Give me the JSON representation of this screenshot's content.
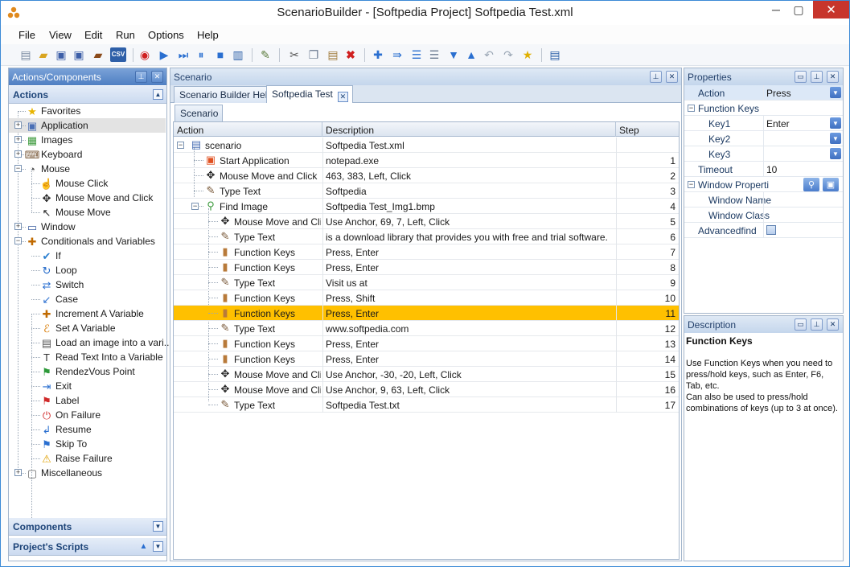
{
  "window": {
    "title": "ScenarioBuilder - [Softpedia Project] Softpedia Test.xml",
    "min": "─",
    "max": "▢",
    "close": "✕"
  },
  "menu": [
    "File",
    "View",
    "Edit",
    "Run",
    "Options",
    "Help"
  ],
  "toolbar": {
    "csv_label": "CSV"
  },
  "left": {
    "title": "Actions/Components",
    "pin": "⊥",
    "close": "✕",
    "actions_header": "Actions",
    "components_header": "Components",
    "scripts_header": "Project's Scripts",
    "tree": [
      {
        "label": "Favorites",
        "icon": "star-icon",
        "glyph": "★",
        "color": "#e8b400"
      },
      {
        "label": "Application",
        "icon": "application-icon",
        "glyph": "▣",
        "color": "#4a6fb5"
      },
      {
        "label": "Images",
        "icon": "images-icon",
        "glyph": "▦",
        "color": "#3c9a3c"
      },
      {
        "label": "Keyboard",
        "icon": "keyboard-icon",
        "glyph": "⌨",
        "color": "#7a5a3a"
      },
      {
        "label": "Mouse",
        "icon": "mouse-icon",
        "glyph": "◔",
        "color": "#555"
      },
      {
        "label": "Mouse Click",
        "icon": "mouse-click-icon",
        "glyph": "☝",
        "color": "#555"
      },
      {
        "label": "Mouse Move and Click",
        "icon": "move-icon",
        "glyph": "✥",
        "color": "#222"
      },
      {
        "label": "Mouse Move",
        "icon": "cursor-icon",
        "glyph": "↖",
        "color": "#222"
      },
      {
        "label": "Window",
        "icon": "window-icon",
        "glyph": "▭",
        "color": "#3a5da0"
      },
      {
        "label": "Conditionals and Variables",
        "icon": "variables-icon",
        "glyph": "✚",
        "color": "#c06a00"
      },
      {
        "label": "If",
        "icon": "if-icon",
        "glyph": "✔",
        "color": "#2a7fd0"
      },
      {
        "label": "Loop",
        "icon": "loop-icon",
        "glyph": "↻",
        "color": "#1e66c8"
      },
      {
        "label": "Switch",
        "icon": "switch-icon",
        "glyph": "⇄",
        "color": "#2a6fd0"
      },
      {
        "label": "Case",
        "icon": "case-icon",
        "glyph": "↙",
        "color": "#2a6fd0"
      },
      {
        "label": "Increment A Variable",
        "icon": "increment-icon",
        "glyph": "✚",
        "color": "#c06a00"
      },
      {
        "label": "Set A Variable",
        "icon": "set-variable-icon",
        "glyph": "ℰ",
        "color": "#d87a00"
      },
      {
        "label": "Load an image into a vari...",
        "icon": "load-image-icon",
        "glyph": "▤",
        "color": "#555"
      },
      {
        "label": "Read Text Into a Variable",
        "icon": "read-text-icon",
        "glyph": "T",
        "color": "#333"
      },
      {
        "label": "RendezVous Point",
        "icon": "rendezvous-icon",
        "glyph": "⚑",
        "color": "#2e9a3a"
      },
      {
        "label": "Exit",
        "icon": "exit-icon",
        "glyph": "⇥",
        "color": "#2a6fd0"
      },
      {
        "label": "Label",
        "icon": "label-icon",
        "glyph": "⚑",
        "color": "#d02a2a"
      },
      {
        "label": "On Failure",
        "icon": "on-failure-icon",
        "glyph": "⏻",
        "color": "#d02a2a"
      },
      {
        "label": "Resume",
        "icon": "resume-icon",
        "glyph": "↲",
        "color": "#2a6fd0"
      },
      {
        "label": "Skip To",
        "icon": "skip-to-icon",
        "glyph": "⚑",
        "color": "#2a6fd0"
      },
      {
        "label": "Raise Failure",
        "icon": "warning-icon",
        "glyph": "⚠",
        "color": "#e0a000"
      },
      {
        "label": "Miscellaneous",
        "icon": "misc-icon",
        "glyph": "▢",
        "color": "#666"
      }
    ]
  },
  "center": {
    "title": "Scenario",
    "pin": "⊥",
    "close": "✕",
    "tabs": [
      {
        "label": "Scenario Builder Help"
      },
      {
        "label": "Softpedia Test"
      }
    ],
    "subtab": "Scenario",
    "columns": [
      "Action",
      "Description",
      "Step"
    ],
    "rows": [
      {
        "action": "scenario",
        "desc": "Softpedia Test.xml",
        "step": "",
        "indent": 0,
        "icon": "scenario-icon",
        "glyph": "▤",
        "color": "#4a6fb5"
      },
      {
        "action": "Start Application",
        "desc": "notepad.exe",
        "step": "1",
        "indent": 1,
        "icon": "application-icon",
        "glyph": "▣",
        "color": "#e05020"
      },
      {
        "action": "Mouse Move and Click",
        "desc": "463, 383, Left, Click",
        "step": "2",
        "indent": 1,
        "icon": "move-icon",
        "glyph": "✥",
        "color": "#222"
      },
      {
        "action": "Type Text",
        "desc": "Softpedia",
        "step": "3",
        "indent": 1,
        "icon": "type-text-icon",
        "glyph": "✎",
        "color": "#7a5a3a"
      },
      {
        "action": "Find Image",
        "desc": "Softpedia Test_Img1.bmp",
        "step": "4",
        "indent": 1,
        "icon": "find-image-icon",
        "glyph": "⚲",
        "color": "#3c9a3c"
      },
      {
        "action": "Mouse Move and Click",
        "desc": "Use Anchor, 69, 7, Left, Click",
        "step": "5",
        "indent": 2,
        "icon": "move-icon",
        "glyph": "✥",
        "color": "#222"
      },
      {
        "action": "Type Text",
        "desc": "is a download library that provides you with free and trial software.",
        "step": "6",
        "indent": 2,
        "icon": "type-text-icon",
        "glyph": "✎",
        "color": "#7a5a3a"
      },
      {
        "action": "Function Keys",
        "desc": "Press, Enter",
        "step": "7",
        "indent": 2,
        "icon": "function-keys-icon",
        "glyph": "▮",
        "color": "#b87a3a"
      },
      {
        "action": "Function Keys",
        "desc": "Press, Enter",
        "step": "8",
        "indent": 2,
        "icon": "function-keys-icon",
        "glyph": "▮",
        "color": "#b87a3a"
      },
      {
        "action": "Type Text",
        "desc": "Visit us at",
        "step": "9",
        "indent": 2,
        "icon": "type-text-icon",
        "glyph": "✎",
        "color": "#7a5a3a"
      },
      {
        "action": "Function Keys",
        "desc": "Press, Shift",
        "step": "10",
        "indent": 2,
        "icon": "function-keys-icon",
        "glyph": "▮",
        "color": "#b87a3a"
      },
      {
        "action": "Function Keys",
        "desc": "Press, Enter",
        "step": "11",
        "indent": 2,
        "icon": "function-keys-icon",
        "glyph": "▮",
        "color": "#b87a3a",
        "selected": true
      },
      {
        "action": "Type Text",
        "desc": "www.softpedia.com",
        "step": "12",
        "indent": 2,
        "icon": "type-text-icon",
        "glyph": "✎",
        "color": "#7a5a3a"
      },
      {
        "action": "Function Keys",
        "desc": "Press, Enter",
        "step": "13",
        "indent": 2,
        "icon": "function-keys-icon",
        "glyph": "▮",
        "color": "#b87a3a"
      },
      {
        "action": "Function Keys",
        "desc": "Press, Enter",
        "step": "14",
        "indent": 2,
        "icon": "function-keys-icon",
        "glyph": "▮",
        "color": "#b87a3a"
      },
      {
        "action": "Mouse Move and Click",
        "desc": "Use Anchor, -30, -20, Left, Click",
        "step": "15",
        "indent": 2,
        "icon": "move-icon",
        "glyph": "✥",
        "color": "#222"
      },
      {
        "action": "Mouse Move and Click",
        "desc": "Use Anchor, 9, 63, Left, Click",
        "step": "16",
        "indent": 2,
        "icon": "move-icon",
        "glyph": "✥",
        "color": "#222"
      },
      {
        "action": "Type Text",
        "desc": "Softpedia Test.txt",
        "step": "17",
        "indent": 2,
        "icon": "type-text-icon",
        "glyph": "✎",
        "color": "#7a5a3a"
      }
    ]
  },
  "properties": {
    "title": "Properties",
    "rows": [
      {
        "name": "Action",
        "value": "Press",
        "dropdown": true,
        "type": "prop",
        "hl": true
      },
      {
        "name": "Function Keys",
        "value": "",
        "type": "cat"
      },
      {
        "name": "Key1",
        "value": "Enter",
        "dropdown": true,
        "type": "sub"
      },
      {
        "name": "Key2",
        "value": "",
        "dropdown": true,
        "type": "sub"
      },
      {
        "name": "Key3",
        "value": "",
        "dropdown": true,
        "type": "sub"
      },
      {
        "name": "Timeout",
        "value": "10",
        "type": "prop"
      },
      {
        "name": "Window Properti",
        "value": "",
        "type": "cat"
      },
      {
        "name": "Window Name",
        "value": "",
        "type": "sub"
      },
      {
        "name": "Window Class",
        "value": "",
        "type": "sub"
      },
      {
        "name": "Advancedfind",
        "value": "",
        "type": "check"
      }
    ]
  },
  "description": {
    "title": "Description",
    "heading": "Function Keys",
    "text1": "Use Function Keys when you need to press/hold keys, such as Enter, F6, Tab, etc.",
    "text2": "Can also be used to press/hold combinations of keys (up to 3 at once)."
  }
}
